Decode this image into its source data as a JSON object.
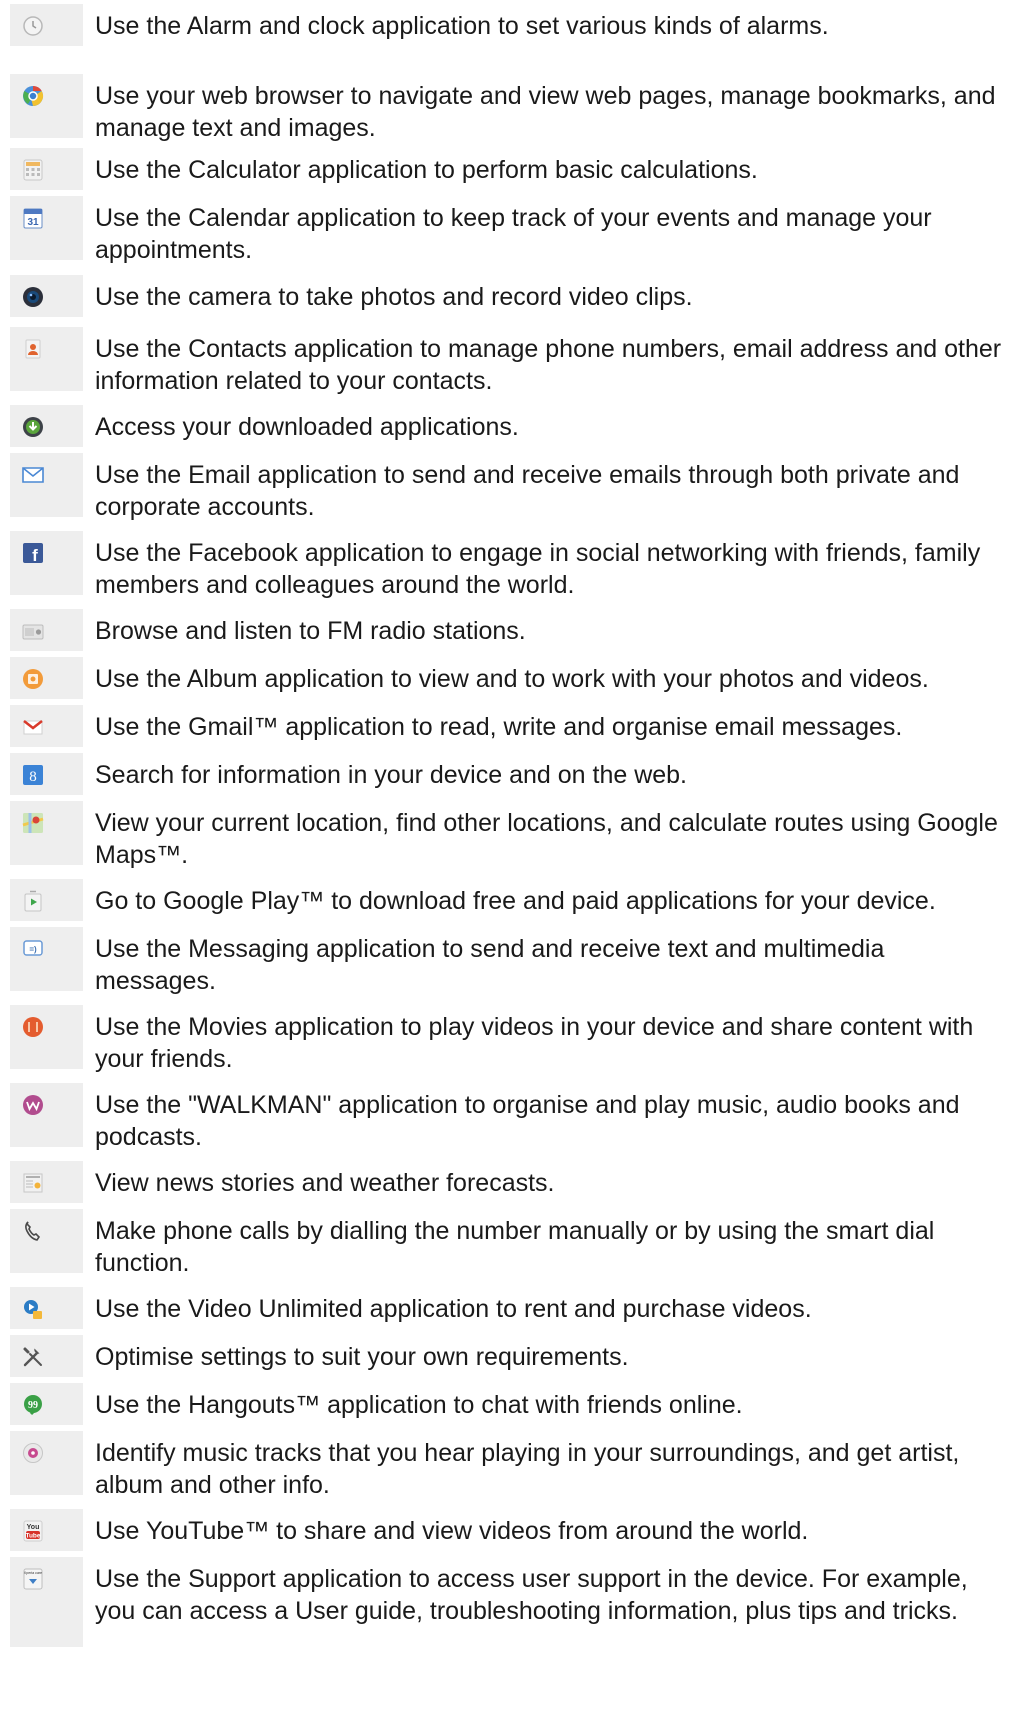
{
  "rows": [
    {
      "icon": "alarm-clock-icon",
      "text": "Use the Alarm and clock application to set various kinds of alarms."
    },
    {
      "icon": "web-browser-icon",
      "text": "Use your web browser to navigate and view web pages, manage bookmarks, and manage text and images."
    },
    {
      "icon": "calculator-icon",
      "text": "Use the Calculator application to perform basic calculations."
    },
    {
      "icon": "calendar-icon",
      "text": "Use the Calendar application to keep track of your events and manage your appointments.",
      "icon_text": "31"
    },
    {
      "icon": "camera-icon",
      "text": "Use the camera to take photos and record video clips."
    },
    {
      "icon": "contacts-icon",
      "text": "Use the Contacts application to manage phone numbers, email address and other information related to your contacts."
    },
    {
      "icon": "downloads-icon",
      "text": "Access your downloaded applications."
    },
    {
      "icon": "email-icon",
      "text": "Use the Email application to send and receive emails through both private and corporate accounts."
    },
    {
      "icon": "facebook-icon",
      "text": "Use the Facebook application to engage in social networking with friends, family members and colleagues around the world.",
      "icon_text": "f"
    },
    {
      "icon": "fm-radio-icon",
      "text": "Browse and listen to FM radio stations."
    },
    {
      "icon": "album-icon",
      "text": "Use the Album application to view and to work with your photos and videos."
    },
    {
      "icon": "gmail-icon",
      "text": "Use the Gmail™ application to read, write and organise email messages."
    },
    {
      "icon": "google-search-icon",
      "text": "Search for information in your device and on the web.",
      "icon_text": "8"
    },
    {
      "icon": "maps-icon",
      "text": "View your current location, find other locations, and calculate routes using Google Maps™."
    },
    {
      "icon": "play-store-icon",
      "text": "Go to Google Play™ to download free and paid applications for your device."
    },
    {
      "icon": "messaging-icon",
      "text": "Use the Messaging application to send and receive text and multimedia messages.",
      "icon_text": "=)"
    },
    {
      "icon": "movies-icon",
      "text": "Use the Movies application to play videos in your device and share content with your friends."
    },
    {
      "icon": "walkman-icon",
      "text": "Use the \"WALKMAN\" application to organise and play music, audio books and podcasts."
    },
    {
      "icon": "news-weather-icon",
      "text": "View news stories and weather forecasts."
    },
    {
      "icon": "phone-icon",
      "text": "Make phone calls by dialling the number manually or by using the smart dial function."
    },
    {
      "icon": "video-unlimited-icon",
      "text": "Use the Video Unlimited application to rent and purchase videos."
    },
    {
      "icon": "settings-icon",
      "text": "Optimise settings to suit your own requirements."
    },
    {
      "icon": "hangouts-icon",
      "text": "Use the Hangouts™ application to chat with friends online."
    },
    {
      "icon": "trackid-icon",
      "text": "Identify music tracks that you hear playing in your surroundings, and get artist, album and other info."
    },
    {
      "icon": "youtube-icon",
      "text": "Use YouTube™ to share and view videos from around the world.",
      "icon_text": "You Tube"
    },
    {
      "icon": "support-icon",
      "text": "Use the Support application to access user support in the device. For example, you can access a User guide, troubleshooting information, plus tips and tricks.",
      "icon_text": "Xperia care"
    }
  ]
}
